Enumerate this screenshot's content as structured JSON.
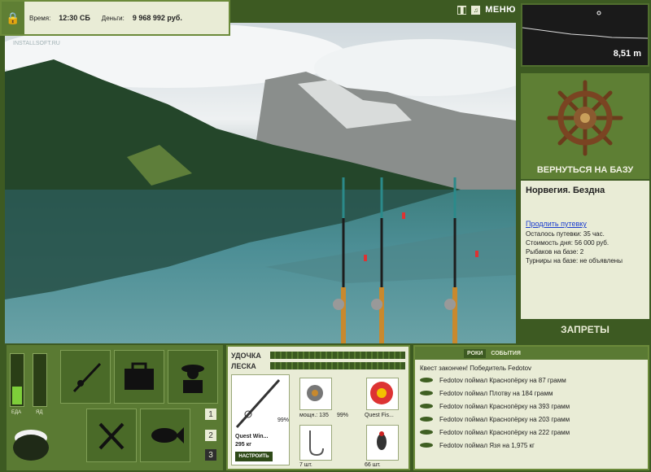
{
  "status": {
    "time_label": "Время:",
    "time": "12:30 СБ",
    "money_label": "Деньги:",
    "money": "9 968 992 руб."
  },
  "watermark": "INSTALLSOFT.RU",
  "top_controls": {
    "menu": "МЕНЮ",
    "pause_icon": "pause-icon",
    "sound_icon": "sound-icon"
  },
  "depth": {
    "value": "8,51 m"
  },
  "base": {
    "return_label": "ВЕРНУТЬСЯ НА БАЗУ",
    "location": "Норвегия. Бездна",
    "extend_link": "Продлить путевку",
    "lines": [
      "Осталось путевки: 35 час.",
      "Стоимость дня: 56 000 руб.",
      "Рыбаков на базе: 2",
      "Турниры на базе: не объявлены"
    ]
  },
  "bans": "ЗАПРЕТЫ",
  "needs": {
    "food_label": "ЕДА",
    "poison_label": "ЯД",
    "food_level": 0.35,
    "poison_level": 0
  },
  "slots": [
    "1",
    "2",
    "3"
  ],
  "tackle": {
    "rod_label": "УДОЧКА",
    "line_label": "ЛЕСКА",
    "rod_name": "Quest Win...",
    "rod_weight": "295 кг",
    "rod_pct": "99%",
    "reel_caption": "мощн.: 135",
    "reel_pct": "99%",
    "line_name": "Quest Fis...",
    "hooks_count": "7 шт.",
    "lure_count": "66 шт.",
    "setup_button": "НАСТРОИТЬ"
  },
  "events": {
    "tab_left": "РОКИ",
    "tab_right": "СОБЫТИЯ",
    "header": "Квест закончен! Победитель Fedotov",
    "items": [
      "Fedotov поймал Краснопёрку на 87 грамм",
      "Fedotov поймал Плотву на 184 грамм",
      "Fedotov поймал Краснопёрку на 393 грамм",
      "Fedotov поймал Краснопёрку на 203 грамм",
      "Fedotov поймал Краснопёрку на 222 грамм",
      "Fedotov поймал Язя на 1,975 кг"
    ]
  }
}
